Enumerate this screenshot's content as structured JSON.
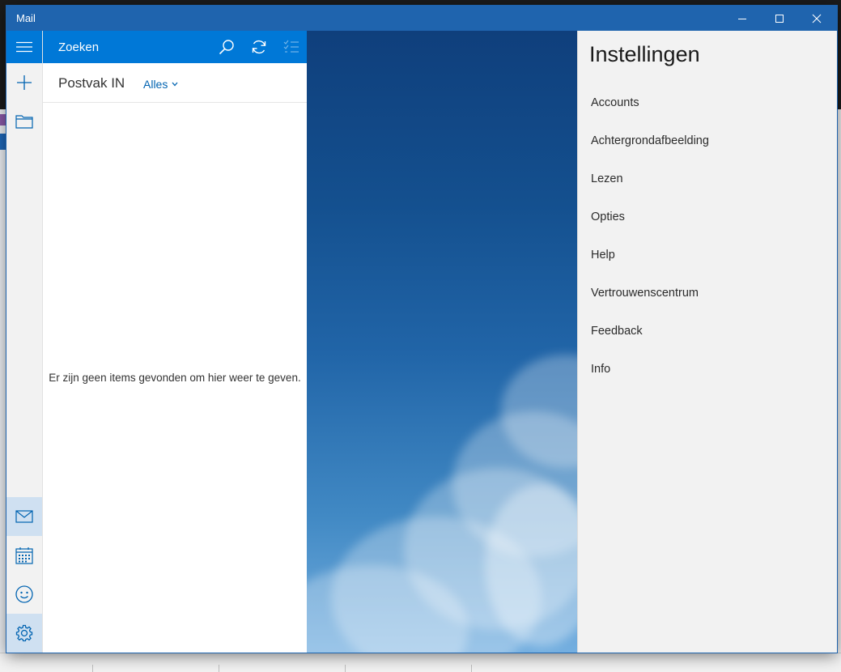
{
  "window": {
    "title": "Mail"
  },
  "search": {
    "label": "Zoeken"
  },
  "folder": {
    "name": "Postvak IN",
    "filter": "Alles"
  },
  "list": {
    "empty_message": "Er zijn geen items gevonden om hier weer te geven."
  },
  "settings": {
    "title": "Instellingen",
    "items": [
      {
        "label": "Accounts"
      },
      {
        "label": "Achtergrondafbeelding"
      },
      {
        "label": "Lezen"
      },
      {
        "label": "Opties"
      },
      {
        "label": "Help"
      },
      {
        "label": "Vertrouwenscentrum"
      },
      {
        "label": "Feedback"
      },
      {
        "label": "Info"
      }
    ]
  },
  "icons": {
    "rail": [
      "hamburger-icon",
      "plus-icon",
      "folder-icon",
      "mail-icon",
      "calendar-icon",
      "smiley-icon",
      "gear-icon"
    ],
    "toolbar": [
      "search-icon",
      "sync-icon",
      "select-icon"
    ]
  },
  "colors": {
    "accent": "#0078d7",
    "titlebar": "#1f64ae",
    "settings_bg": "#f2f2f2"
  }
}
